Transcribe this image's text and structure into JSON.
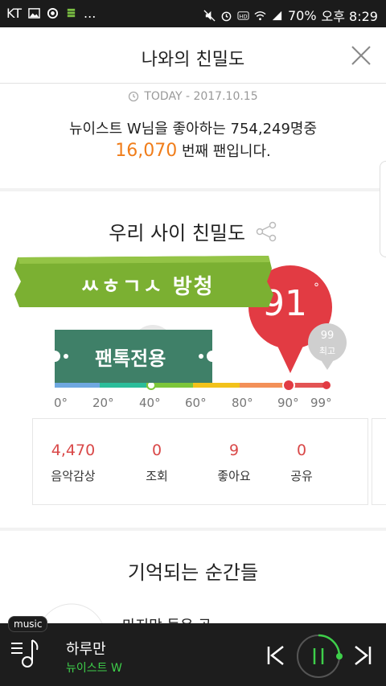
{
  "status_bar": {
    "carrier": "KT",
    "battery": "70%",
    "time": "오후 8:29",
    "ellipsis": "..."
  },
  "header": {
    "title": "나와의 친밀도"
  },
  "fan_info": {
    "today_label": "TODAY - 2017.10.15",
    "line1": "뉴이스트 W님을 좋아하는 754,249명중",
    "rank": "16,070",
    "rank_suffix": " 번째 팬입니다."
  },
  "intimacy": {
    "title": "우리 사이 친밀도",
    "current": "91",
    "degree": "°",
    "max_value": "99",
    "max_label": "최고",
    "sticker_top": "ㅆㅎㄱㅅ 방청",
    "sticker_bottom": "팬톡전용",
    "ticks": [
      "0°",
      "20°",
      "40°",
      "60°",
      "80°",
      "90°",
      "99°"
    ]
  },
  "stats": [
    {
      "value": "4,470",
      "label": "음악감상"
    },
    {
      "value": "0",
      "label": "조회"
    },
    {
      "value": "9",
      "label": "좋아요"
    },
    {
      "value": "0",
      "label": "공유"
    }
  ],
  "memories": {
    "title": "기억되는 순간들",
    "partial_text": "마지막 듣은 곡"
  },
  "player": {
    "tag": "music",
    "song": "하루만",
    "artist": "뉴이스트 W"
  },
  "colors": {
    "accent_red": "#e23b43",
    "rank_orange": "#f07d1a",
    "player_green": "#3ecf4a"
  }
}
